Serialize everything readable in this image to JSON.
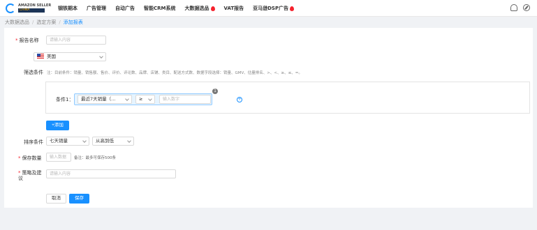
{
  "header": {
    "logo_line1": "AMAZON SELLER",
    "logo_line2": "CHINA",
    "nav": [
      {
        "label": "钢铁期本",
        "hot": false
      },
      {
        "label": "广告管理",
        "hot": false
      },
      {
        "label": "自动广告",
        "hot": false
      },
      {
        "label": "智能CRM系统",
        "hot": false
      },
      {
        "label": "大数据选品",
        "hot": true
      },
      {
        "label": "VAT报告",
        "hot": false
      },
      {
        "label": "亚马逊DSP广告",
        "hot": true
      }
    ]
  },
  "breadcrumb": [
    "大数据选品",
    "选定方案",
    "添加报表"
  ],
  "form": {
    "name_label": "报告名称",
    "name_placeholder": "请输入内容",
    "country_value": "美国",
    "filter_label": "筛选条件",
    "filter_hint": "注：目前条件：销量、销售额、售价、评价、评论数、品牌、店铺、类目、配送方式数、数据字段选择：销量、GMV、估量排名、>、<、≥、≤、=。",
    "condition": {
      "label": "条件1",
      "field": "最近7天销量（...",
      "operator": "≥",
      "value_placeholder": "输入数字",
      "badge": "1"
    },
    "add_button": "+添加",
    "sort_label": "排序条件",
    "sort_field": "七天销量",
    "sort_order": "从高到低",
    "save_count_label": "保存数量",
    "save_count_placeholder": "输入数据",
    "save_count_note": "备注：最多可保存500条",
    "remark_label": "策略及建议",
    "remark_placeholder": "请输入内容",
    "cancel_button": "取消",
    "save_button": "保存"
  },
  "colors": {
    "accent": "#1890ff",
    "required": "#f5222d"
  }
}
